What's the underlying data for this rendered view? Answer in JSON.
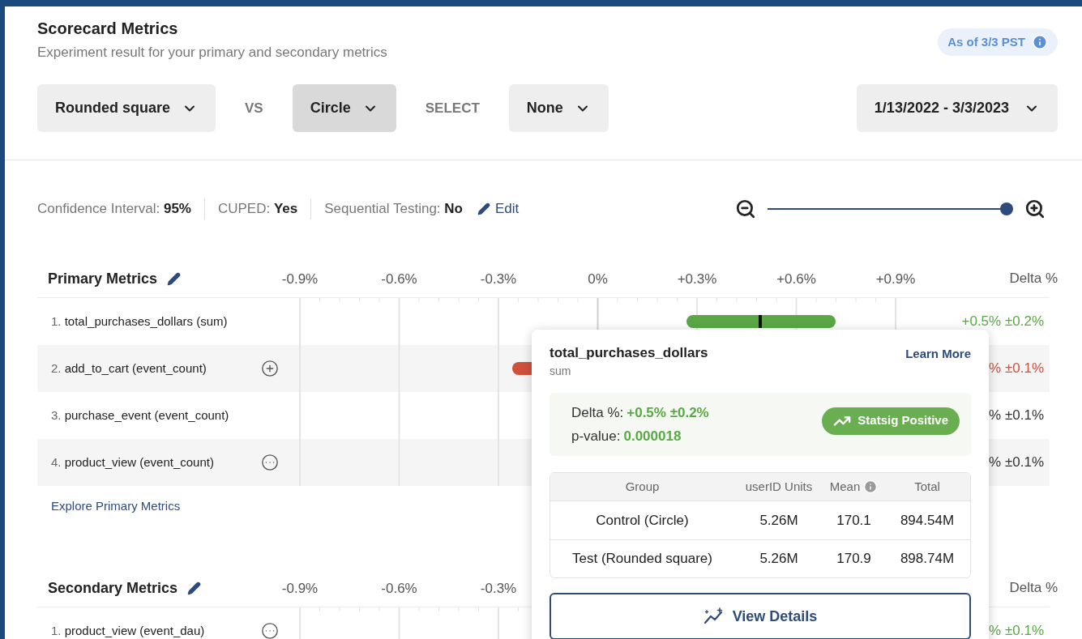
{
  "header": {
    "title": "Scorecard Metrics",
    "subtitle": "Experiment result for your primary and secondary metrics",
    "badge": "As of 3/3 PST"
  },
  "selectors": [
    {
      "kind": "dropdown",
      "label": "Rounded square",
      "selected": false
    },
    {
      "kind": "text",
      "label": "VS"
    },
    {
      "kind": "dropdown",
      "label": "Circle",
      "selected": true
    },
    {
      "kind": "text",
      "label": "SELECT"
    },
    {
      "kind": "dropdown",
      "label": "None",
      "selected": false
    }
  ],
  "date_range": "1/13/2022 - 3/3/2023",
  "settings": [
    {
      "label": "Confidence Interval:",
      "value": "95%"
    },
    {
      "label": "CUPED:",
      "value": "Yes"
    },
    {
      "label": "Sequential Testing:",
      "value": "No"
    }
  ],
  "edit_link": "Edit",
  "zoom_slider": {
    "level": 1
  },
  "primary_metrics": {
    "title": "Primary Metrics",
    "delta_heading": "Delta %",
    "axis_labels": [
      "-0.9%",
      "-0.6%",
      "-0.3%",
      "0%",
      "+0.3%",
      "+0.6%",
      "+0.9%"
    ],
    "rows": [
      {
        "number": "1.",
        "name": "total_purchases_dollars (sum)",
        "delta": "+0.5% ±0.2%",
        "color": "#5aa845",
        "kind": "plain"
      },
      {
        "number": "2.",
        "name": "add_to_cart (event_count)",
        "delta": "% ±0.1%",
        "color": "#d0503c",
        "kind": "plus"
      },
      {
        "number": "3.",
        "name": "purchase_event (event_count)",
        "delta": "% ±0.1%",
        "color": "#333333",
        "kind": "plain"
      },
      {
        "number": "4.",
        "name": "product_view (event_count)",
        "delta": "% ±0.1%",
        "color": "#333333",
        "kind": "more"
      }
    ],
    "link": "Explore Primary Metrics"
  },
  "secondary_metrics": {
    "title": "Secondary Metrics",
    "delta_heading": "Delta %",
    "axis_labels": [
      "-0.9%",
      "-0.6%",
      "-0.3%"
    ],
    "rows": [
      {
        "number": "1.",
        "name": "product_view (event_dau)",
        "delta": "% ±0.1%",
        "color": "#5aa845",
        "kind": "more"
      }
    ]
  },
  "popover": {
    "title": "total_purchases_dollars",
    "subtitle": "sum",
    "link": "Learn More",
    "delta_label": "Delta %:",
    "delta_value": "+0.5% ±0.2%",
    "pvalue_label": "p-value:",
    "pvalue_value": "0.000018",
    "badge": "Statsig Positive",
    "table": {
      "columns": [
        {
          "label": "Group",
          "info": false
        },
        {
          "label": "userID Units",
          "info": false
        },
        {
          "label": "Mean",
          "info": true
        },
        {
          "label": "Total",
          "info": false
        }
      ],
      "rows": [
        [
          "Control (Circle)",
          "5.26M",
          "170.1",
          "894.54M"
        ],
        [
          "Test (Rounded square)",
          "5.26M",
          "170.9",
          "898.74M"
        ]
      ]
    },
    "button": "View Details"
  }
}
